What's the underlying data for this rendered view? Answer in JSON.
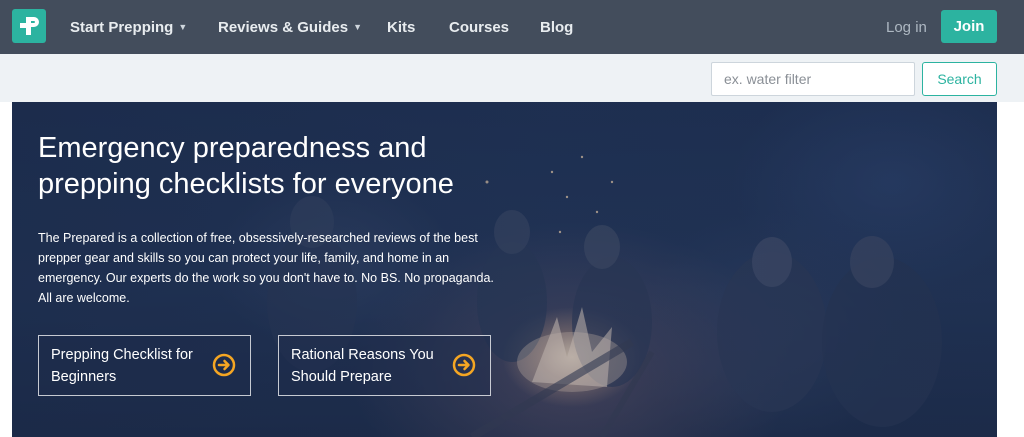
{
  "nav": {
    "logo_icon": "plus-letter-p-icon",
    "items": [
      {
        "label": "Start Prepping",
        "has_caret": true
      },
      {
        "label": "Reviews & Guides",
        "has_caret": true
      },
      {
        "label": "Kits",
        "has_caret": false
      },
      {
        "label": "Courses",
        "has_caret": false
      },
      {
        "label": "Blog",
        "has_caret": false
      }
    ],
    "caret": "▼",
    "login_label": "Log in",
    "join_label": "Join"
  },
  "search": {
    "placeholder": "ex. water filter",
    "value": "",
    "button_label": "Search"
  },
  "hero": {
    "title": "Emergency preparedness and prepping checklists for everyone",
    "description": "The Prepared is a collection of free, obsessively-researched reviews of the best prepper gear and skills so you can protect your life, family, and home in an emergency. Our experts do the work so you don't have to. No BS. No propaganda. All are welcome.",
    "buttons": [
      {
        "label": "Prepping Checklist for Beginners",
        "icon": "arrow-right-circle-icon"
      },
      {
        "label": "Rational Reasons You Should Prepare",
        "icon": "arrow-right-circle-icon"
      }
    ]
  },
  "colors": {
    "nav_bg": "#434d5c",
    "accent": "#2cb3a0",
    "search_bar_bg": "#eef2f5",
    "hero_bg": "#233659",
    "arrow_icon": "#f5a623"
  }
}
